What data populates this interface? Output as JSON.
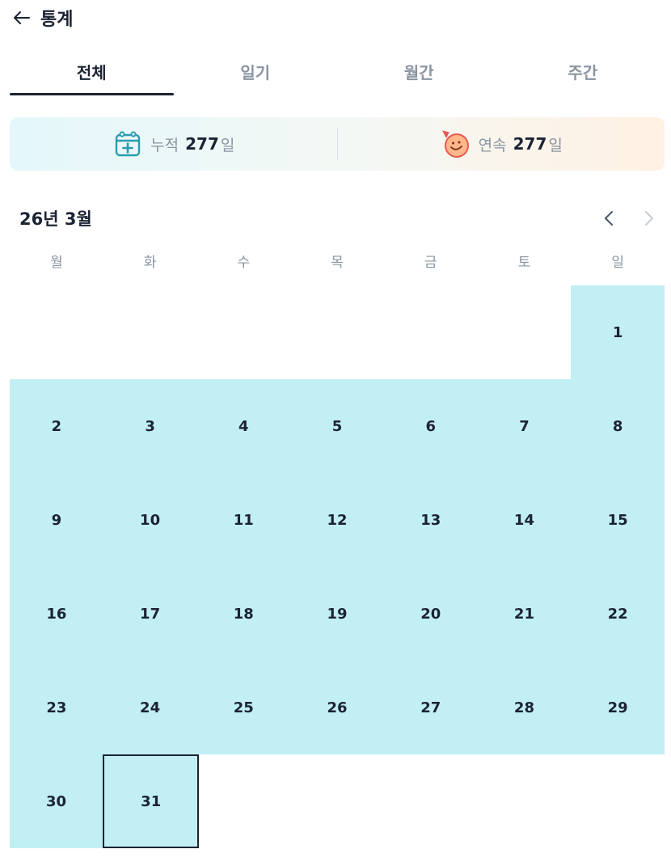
{
  "header": {
    "back_icon": "arrow-left-icon",
    "title": "통계"
  },
  "tabs": [
    {
      "label": "전체",
      "active": true
    },
    {
      "label": "일기",
      "active": false
    },
    {
      "label": "월간",
      "active": false
    },
    {
      "label": "주간",
      "active": false
    }
  ],
  "stats": {
    "cumulative": {
      "icon": "calendar-plus-icon",
      "label": "누적",
      "value": "277",
      "unit": "일"
    },
    "streak": {
      "icon": "smiley-balloon-icon",
      "label": "연속",
      "value": "277",
      "unit": "일"
    }
  },
  "calendar": {
    "month_label": "26년 3월",
    "prev_icon": "chevron-left-icon",
    "next_icon": "chevron-right-icon",
    "weekdays": [
      "월",
      "화",
      "수",
      "목",
      "금",
      "토",
      "일"
    ],
    "weeks": [
      [
        "",
        "",
        "",
        "",
        "",
        "",
        "1"
      ],
      [
        "2",
        "3",
        "4",
        "5",
        "6",
        "7",
        "8"
      ],
      [
        "9",
        "10",
        "11",
        "12",
        "13",
        "14",
        "15"
      ],
      [
        "16",
        "17",
        "18",
        "19",
        "20",
        "21",
        "22"
      ],
      [
        "23",
        "24",
        "25",
        "26",
        "27",
        "28",
        "29"
      ],
      [
        "30",
        "31",
        "",
        "",
        "",
        "",
        ""
      ]
    ],
    "today": "31"
  },
  "colors": {
    "filled_day": "#c2eff4",
    "text_primary": "#1c2333",
    "text_muted": "#8a94a2",
    "calendar_icon": "#2a9db0",
    "smiley_icon": "#f07a3c"
  }
}
